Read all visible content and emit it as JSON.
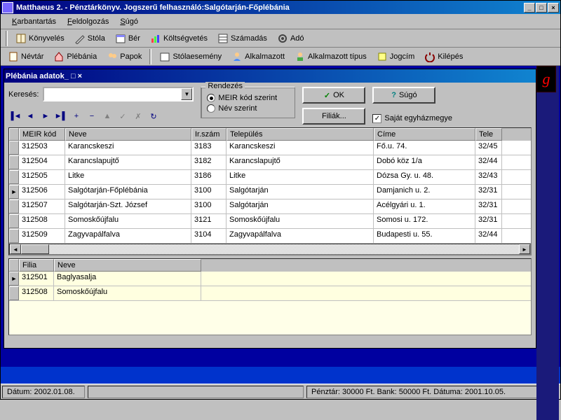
{
  "app": {
    "title": "Matthaeus 2. - Pénztárkönyv. Jogszerű felhasználó:Salgótarján-Főplébánia"
  },
  "menu": {
    "items": [
      "Karbantartás",
      "Feldolgozás",
      "Súgó"
    ]
  },
  "toolbar1": {
    "items": [
      "Könyvelés",
      "Stóla",
      "Bér",
      "Költségvetés",
      "Számadás",
      "Adó"
    ]
  },
  "toolbar2": {
    "items": [
      "Névtár",
      "Plébánia",
      "Papok",
      "Stólaesemény",
      "Alkalmazott",
      "Alkalmazott típus",
      "Jogcím",
      "Kilépés"
    ]
  },
  "subwindow": {
    "title": "Plébánia adatok",
    "search_label": "Keresés:",
    "sort_group": "Rendezés",
    "radio_meir": "MEIR kód szerint",
    "radio_name": "Név szerint",
    "btn_ok": "OK",
    "btn_help": "Súgó",
    "btn_filiak": "Filiák...",
    "chk_sajat": "Saját egyházmegye"
  },
  "grid": {
    "headers": [
      "MEIR kód",
      "Neve",
      "Ir.szám",
      "Település",
      "Címe",
      "Tele"
    ],
    "widths": [
      66,
      180,
      50,
      210,
      145,
      38
    ],
    "rows": [
      {
        "meir": "312503",
        "neve": "Karancskeszi",
        "ir": "3183",
        "tel": "Karancskeszi",
        "cim": "Fő.u. 74.",
        "t": "32/45"
      },
      {
        "meir": "312504",
        "neve": "Karancslapujtő",
        "ir": "3182",
        "tel": "Karancslapujtő",
        "cim": "Dobó köz 1/a",
        "t": "32/44"
      },
      {
        "meir": "312505",
        "neve": "Litke",
        "ir": "3186",
        "tel": "Litke",
        "cim": "Dózsa Gy. u. 48.",
        "t": "32/43"
      },
      {
        "meir": "312506",
        "neve": "Salgótarján-Főplébánia",
        "ir": "3100",
        "tel": "Salgótarján",
        "cim": "Damjanich u. 2.",
        "t": "32/31"
      },
      {
        "meir": "312507",
        "neve": "Salgótarján-Szt. József",
        "ir": "3100",
        "tel": "Salgótarján",
        "cim": "Acélgyári u. 1.",
        "t": "32/31"
      },
      {
        "meir": "312508",
        "neve": "Somoskőújfalu",
        "ir": "3121",
        "tel": "Somoskőújfalu",
        "cim": "Somosi u. 172.",
        "t": "32/31"
      },
      {
        "meir": "312509",
        "neve": "Zagyvapálfalva",
        "ir": "3104",
        "tel": "Zagyvapálfalva",
        "cim": "Budapesti u. 55.",
        "t": "32/44"
      }
    ],
    "current_row": 3
  },
  "filia": {
    "headers": [
      "Filia",
      "Neve"
    ],
    "widths": [
      50,
      210
    ],
    "rows": [
      {
        "filia": "312501",
        "neve": "Baglyasalja"
      },
      {
        "filia": "312508",
        "neve": "Somoskőújfalu"
      }
    ]
  },
  "status": {
    "date": "Dátum: 2002.01.08.",
    "bank": "Pénztár: 30000 Ft. Bank: 50000 Ft. Dátuma: 2001.10.05."
  },
  "glyphs": {
    "min": "_",
    "max": "□",
    "close": "×",
    "down": "▼",
    "left": "◄",
    "right": "►",
    "check": "✓",
    "first": "▐◄",
    "last": "►▌",
    "prev": "◄",
    "next": "►",
    "plus": "+",
    "minus": "−",
    "edit": "▲",
    "ok": "✓",
    "cancel": "✗",
    "refresh": "↻",
    "help": "?",
    "ptr": "►"
  }
}
